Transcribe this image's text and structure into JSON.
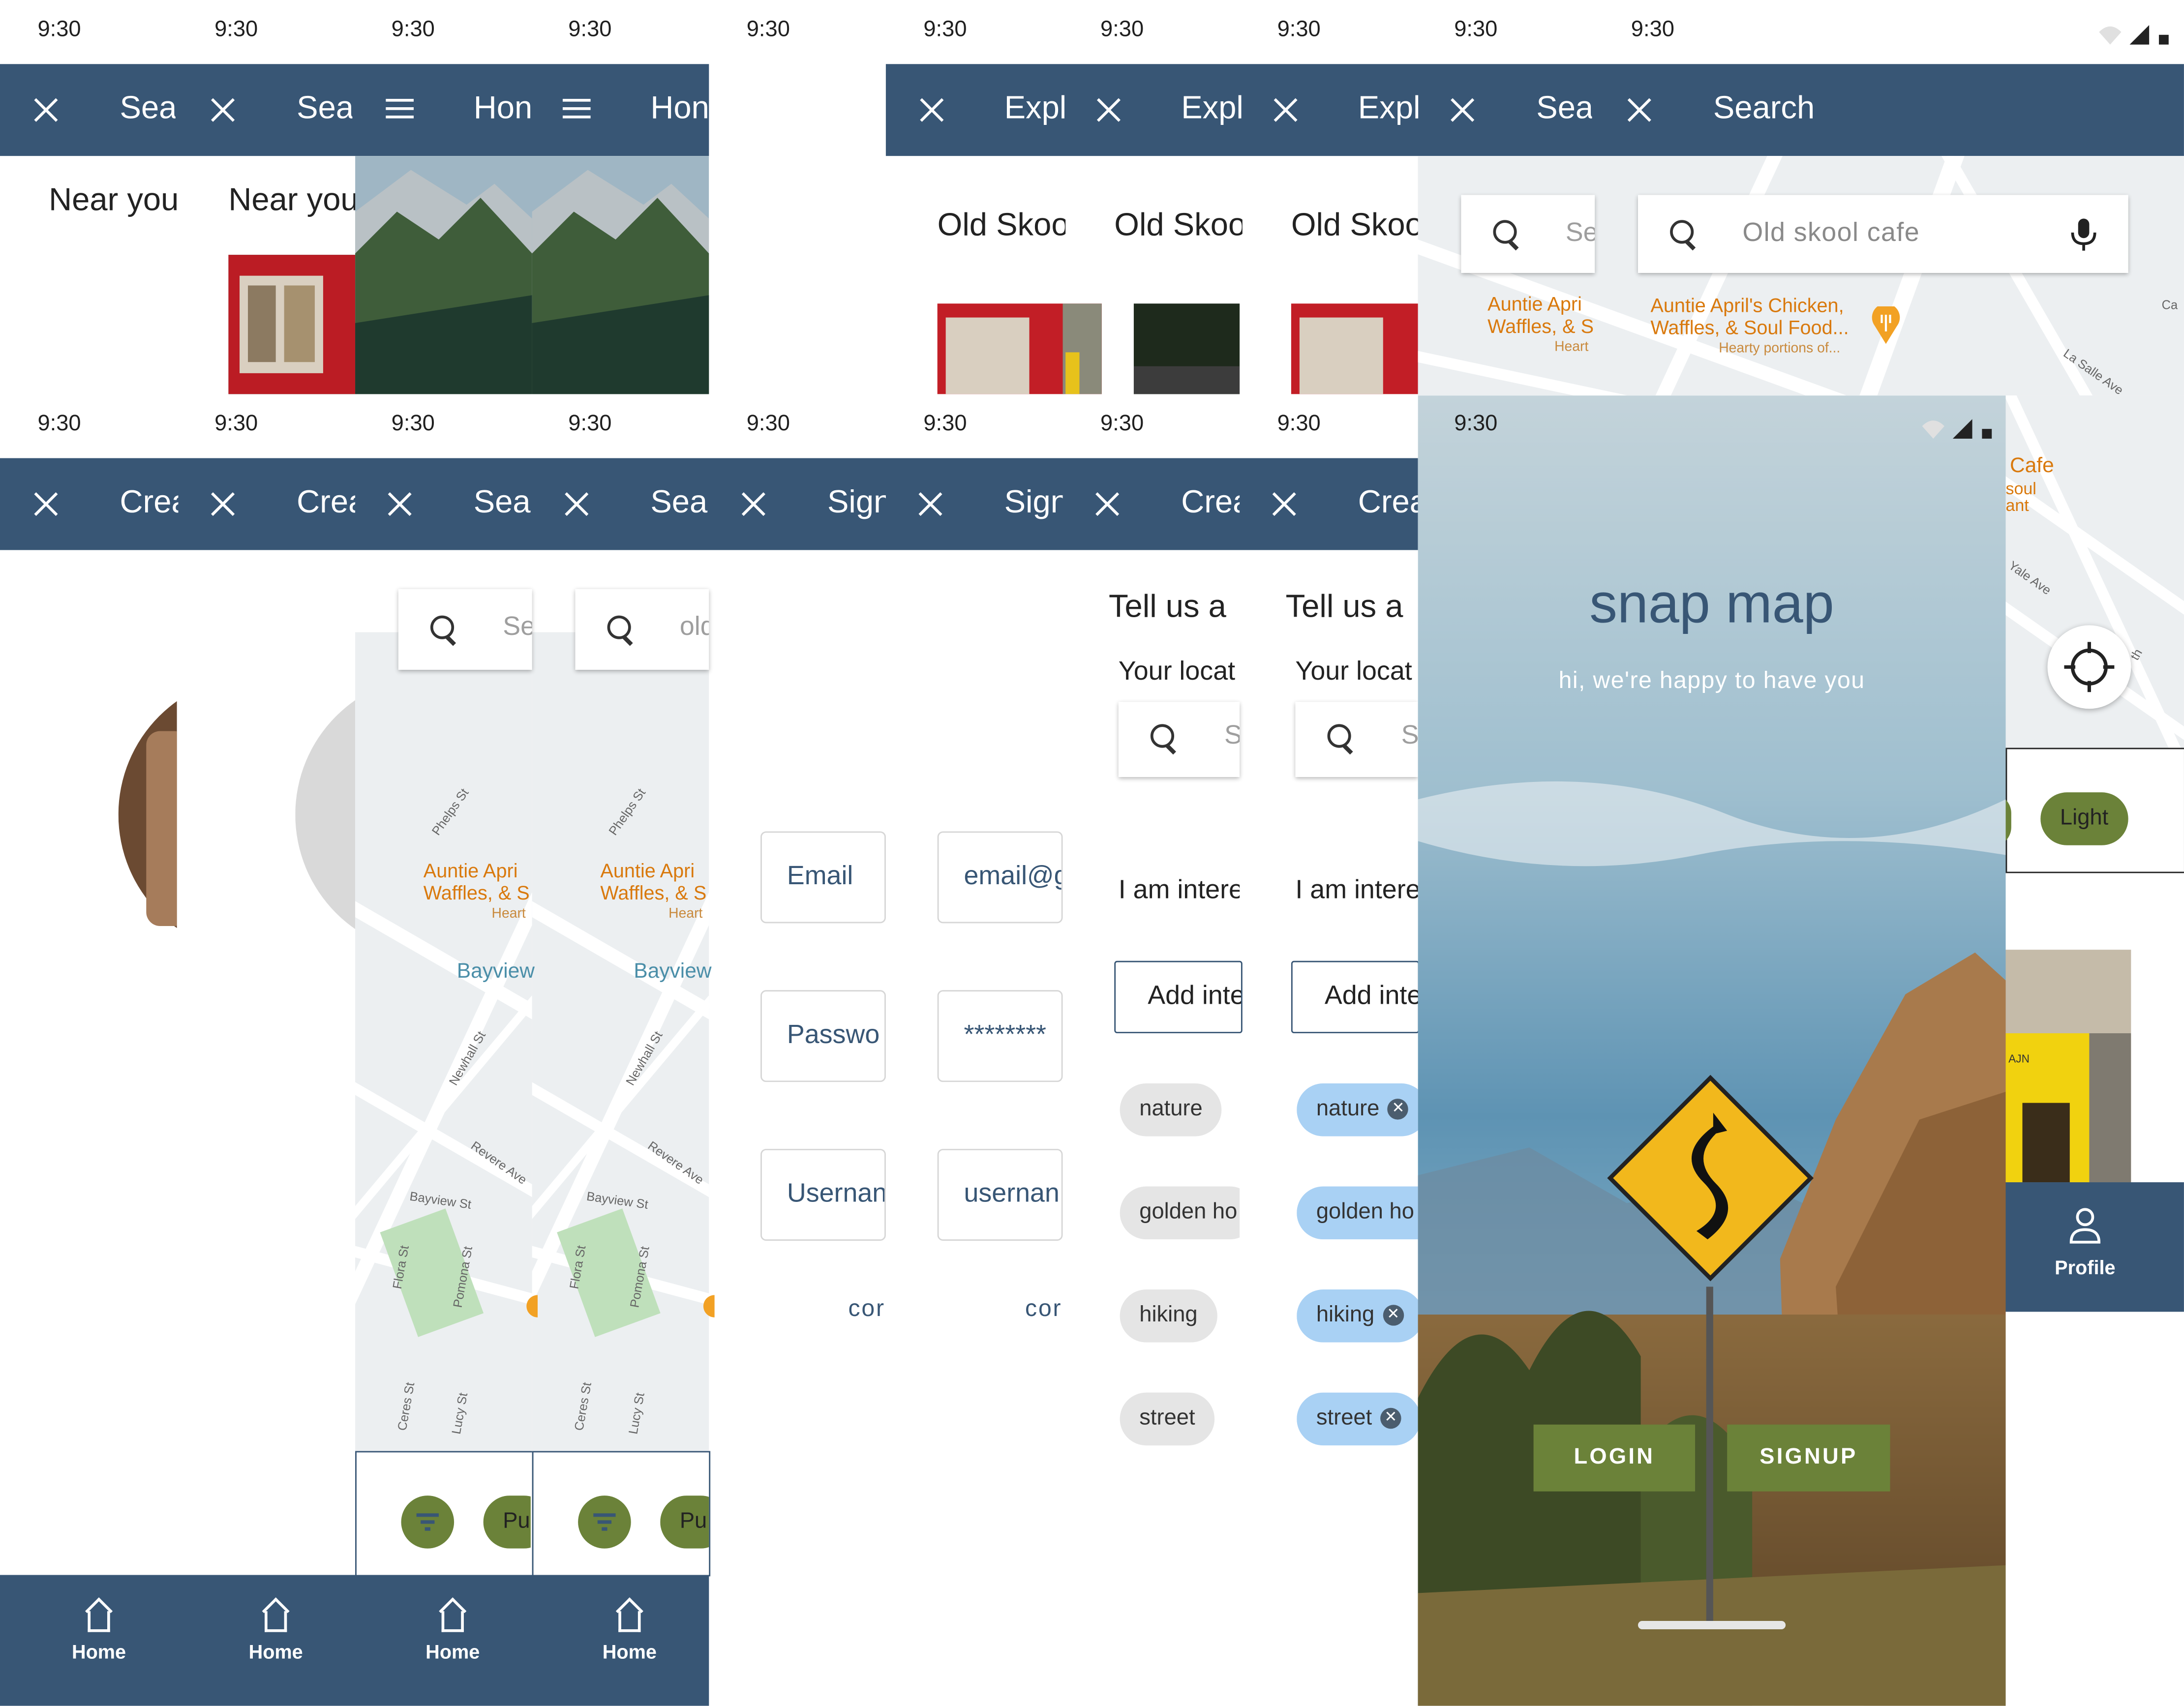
{
  "status": {
    "time": "9:30"
  },
  "colors": {
    "app_bar": "#385675",
    "accent_green": "#6b8239",
    "chip_blue": "#a9d1f4",
    "chip_grey": "#e5e5e5",
    "poi_orange": "#d9790d"
  },
  "row1": {
    "titles": [
      "Sea",
      "Sea",
      "Hon",
      "Hon",
      "Expl",
      "Expl",
      "Expl",
      "Sea",
      "Search"
    ],
    "near_you": [
      "Near you",
      "Near you"
    ],
    "old_skool": [
      "Old Skoo",
      "Old Skoo",
      "Old Skoo"
    ],
    "search_placeholder_short": "Se",
    "search_value": "Old skool cafe",
    "poi_name_line1": "Auntie April's Chicken,",
    "poi_name_line2": "Waffles, & Soul Food...",
    "poi_sub": "Hearty portions of...",
    "poi_short_line1": "Auntie Apri",
    "poi_short_line2": "Waffles, & S",
    "poi_short_sub": "Heart",
    "map_labels": {
      "la_salle": "La Salle Ave",
      "ca": "Ca",
      "yale": "Yale Ave",
      "cafe": "Cafe",
      "soul": "soul",
      "ant": "ant",
      "th": "th"
    },
    "light_chip": "Light",
    "profile_label": "Profile",
    "sign_text": "AJN"
  },
  "row2": {
    "titles": [
      "Crea",
      "Crea",
      "Sea",
      "Sea",
      "Sign",
      "Sign",
      "Crea",
      "Crea"
    ],
    "search_short": [
      "Se",
      "old"
    ],
    "poi_short_line1": "Auntie Apri",
    "poi_short_line2": "Waffles, & S",
    "poi_short_sub": "Heart",
    "bayview": "Bayview",
    "streets": {
      "phelps": "Phelps St",
      "newhall": "Newhall St",
      "revere": "Revere Ave",
      "bayview_st": "Bayview St",
      "flora": "Flora St",
      "pomona": "Pomona St",
      "ceres": "Ceres St",
      "lucy": "Lucy St"
    },
    "pill_short": "Pu",
    "nav_label": "Home",
    "signup_fields": [
      {
        "label_a": "Email",
        "label_b": "email@g"
      },
      {
        "label_a": "Passwo",
        "label_b": "********"
      },
      {
        "label_a": "Usernan",
        "label_b": "usernan"
      }
    ],
    "continue_short": "cor",
    "tell_us": "Tell us a",
    "your_location": "Your locat",
    "location_placeholder": "S",
    "interested": "I am intere",
    "add_interest": "Add inte",
    "interests": [
      "nature",
      "golden ho",
      "hiking",
      "street"
    ],
    "chip_remove": "✕"
  },
  "splash": {
    "title": "snap map",
    "subtitle": "hi, we're happy to have you",
    "login": "LOGIN",
    "signup": "SIGNUP"
  }
}
